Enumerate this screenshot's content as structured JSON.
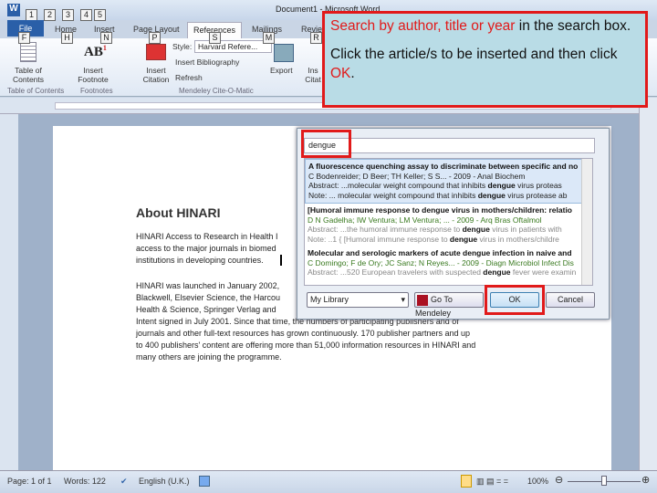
{
  "app": {
    "title": "Document1 - Microsoft Word"
  },
  "quick_access": [
    "1",
    "2",
    "3",
    "4",
    "5"
  ],
  "tabs": [
    {
      "label": "File",
      "key": "F"
    },
    {
      "label": "Home",
      "key": "H"
    },
    {
      "label": "Insert",
      "key": "N"
    },
    {
      "label": "Page Layout",
      "key": "P"
    },
    {
      "label": "References",
      "key": "S"
    },
    {
      "label": "Mailings",
      "key": "M"
    },
    {
      "label": "Review",
      "key": "R"
    }
  ],
  "ribbon": {
    "toc": "Table of Contents",
    "insert_footnote": "Insert Footnote",
    "insert_citation": "Insert Citation",
    "style_label": "Style:",
    "style_value": "Harvard Refere...",
    "insert_bibliography": "Insert Bibliography",
    "refresh": "Refresh",
    "export": "Export",
    "insert_citation2": "Ins Citat",
    "groups": [
      "Table of Contents",
      "Footnotes",
      "Mendeley Cite-O-Matic"
    ]
  },
  "document": {
    "heading": "About HINARI",
    "p1": [
      "HINARI Access to Research in Health I",
      "access to the major journals in biomed",
      "institutions in developing countries."
    ],
    "p2": [
      "HINARI was launched in January 2002,",
      "Blackwell, Elsevier Science, the Harcou",
      "Health & Science, Springer Verlag and",
      "Intent signed in July 2001. Since that time, the numbers of participating publishers and of",
      "journals and other full-text resources has grown continuously. 170 publisher partners and up",
      "to 400 publishers' content are offering more than 51,000 information resources in HINARI and",
      "many others are joining the programme."
    ]
  },
  "dialog": {
    "search_value": "dengue",
    "results": [
      {
        "title": "A fluorescence quenching assay to discriminate between specific and no",
        "authors": "C Bodenreider; D Beer; TH Keller; S S... - 2009 - Anal Biochem",
        "abstract": "Abstract: ...molecular weight compound that inhibits dengue virus proteas",
        "note": "Note: ... molecular weight compound that inhibits dengue virus protease ab"
      },
      {
        "title": "[Humoral immune response to dengue virus in mothers/children: relatio",
        "authors": "D N Gadelha; IW Ventura; LM Ventura; ... - 2009 - Arq Bras Oftalmol",
        "abstract": "Abstract: ...the humoral immune response to dengue virus in patients with",
        "note": "Note: ..1 { [Humoral immune response to dengue virus in mothers/childre"
      },
      {
        "title": "Molecular and serologic markers of acute dengue infection in naive and",
        "authors": "C Domingo; F de Ory; JC Sanz; N Reyes... - 2009 - Diagn Microbiol Infect Dis",
        "abstract": "Abstract: ...520 European travelers with suspected dengue fever were examin",
        "note": ""
      }
    ],
    "library_select": "My Library",
    "go_to_mendeley": "Go To Mendeley",
    "ok": "OK",
    "cancel": "Cancel"
  },
  "callout": {
    "line1a": "Search by author, title or year",
    "line1b": " in the search box.",
    "line2a": "Click the article/s to be inserted and then click ",
    "line2b": "OK",
    "line2c": "."
  },
  "status": {
    "page": "Page: 1 of 1",
    "words": "Words: 122",
    "language": "English (U.K.)",
    "zoom": "100%",
    "zoom_level": 100
  },
  "colors": {
    "highlight": "#e11a1a",
    "callout_bg": "#b9dce6",
    "file_tab": "#2a5fa8"
  }
}
